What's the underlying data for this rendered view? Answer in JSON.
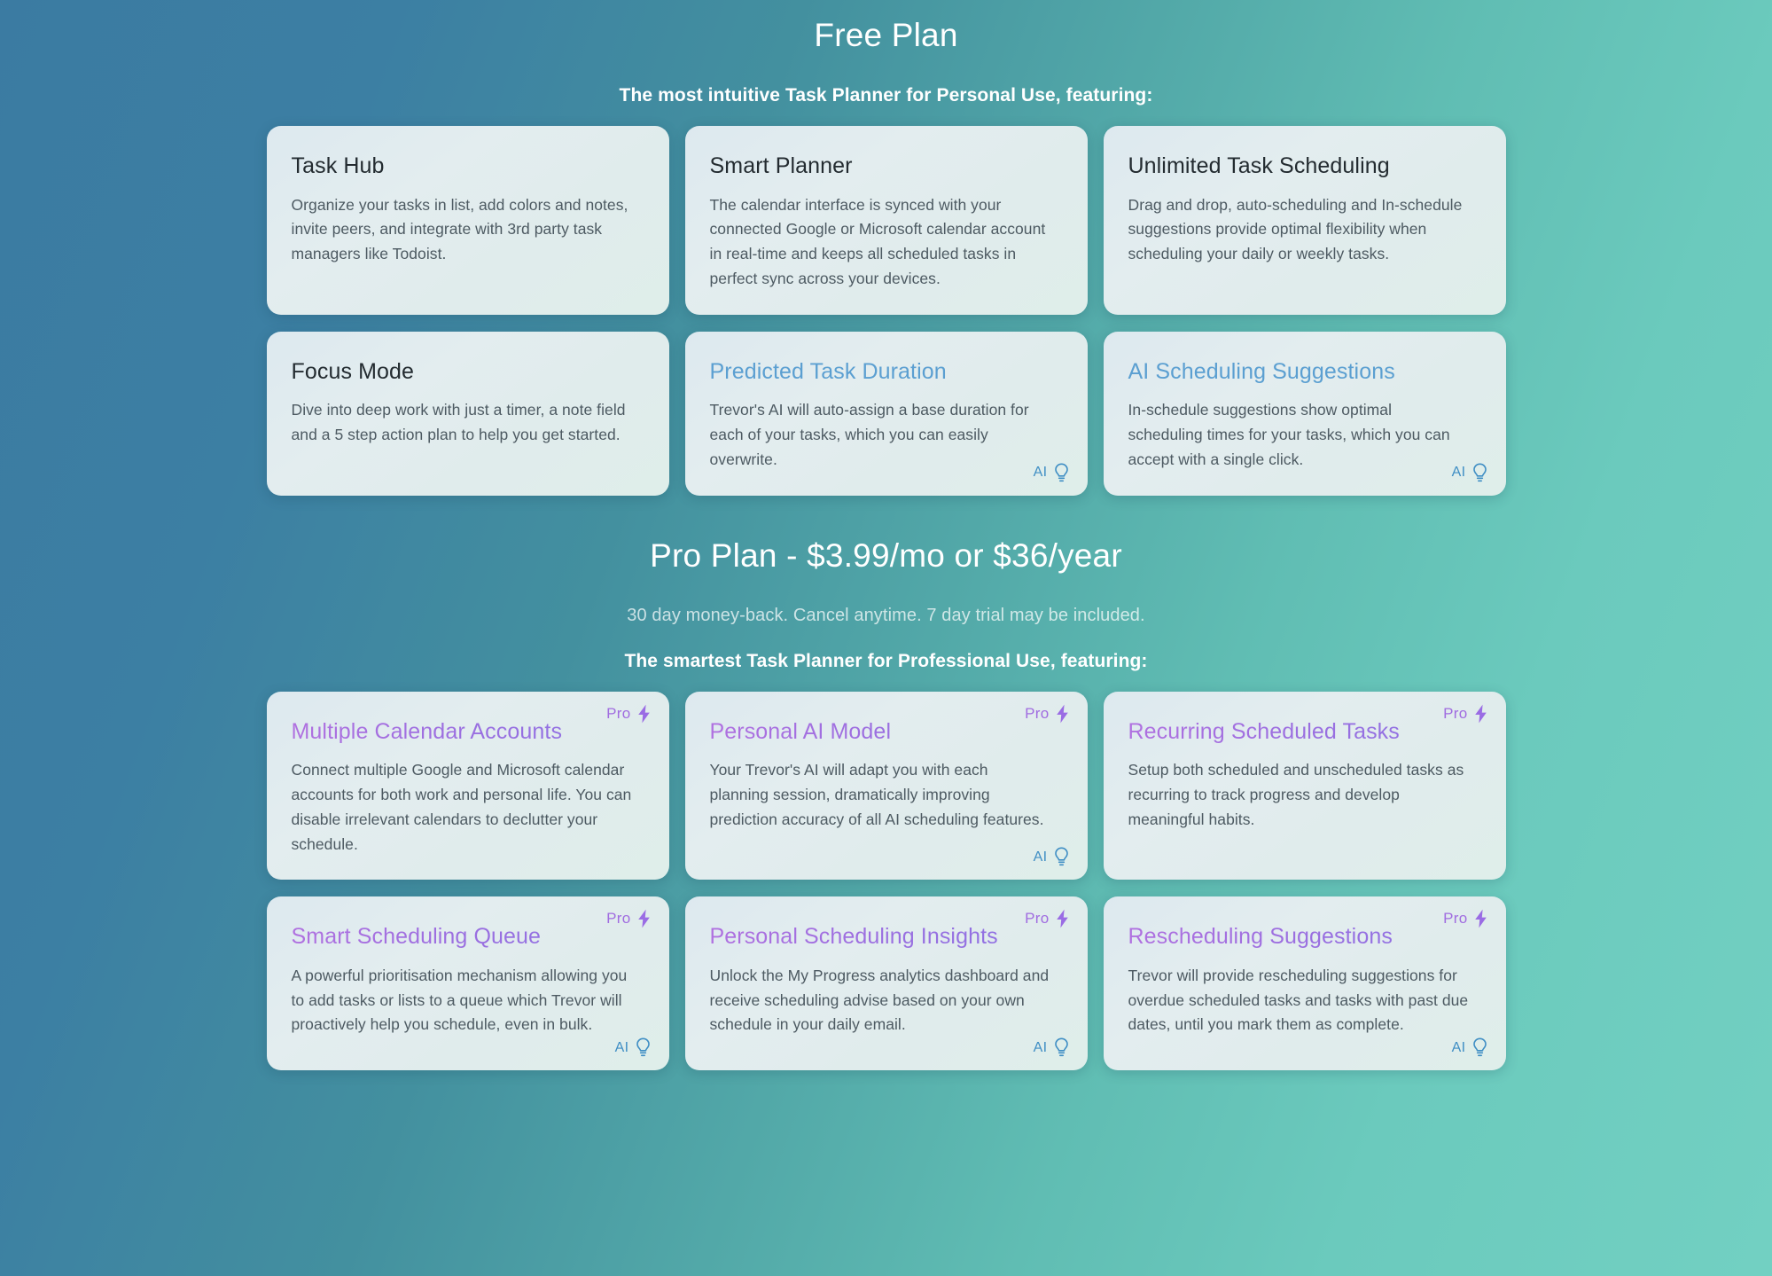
{
  "free_plan": {
    "title": "Free Plan",
    "subtitle": "The most intuitive Task Planner for Personal Use, featuring:",
    "cards": [
      {
        "title": "Task Hub",
        "desc": "Organize your tasks in list, add colors and notes, invite peers, and integrate with 3rd party task managers like Todoist.",
        "ai": false,
        "pro": false
      },
      {
        "title": "Smart Planner",
        "desc": "The calendar interface is synced with your connected Google or Microsoft calendar account in real-time and keeps all scheduled tasks in perfect sync across your devices.",
        "ai": false,
        "pro": false
      },
      {
        "title": "Unlimited Task Scheduling",
        "desc": "Drag and drop, auto-scheduling and In-schedule suggestions provide optimal flexibility when scheduling your daily or weekly tasks.",
        "ai": false,
        "pro": false
      },
      {
        "title": "Focus Mode",
        "desc": "Dive into deep work with just a timer, a note field and a 5 step action plan to help you get started.",
        "ai": false,
        "pro": false
      },
      {
        "title": "Predicted Task Duration",
        "desc": "Trevor's AI will auto-assign a base duration for each of your tasks, which you can easily overwrite.",
        "ai": true,
        "pro": false
      },
      {
        "title": "AI Scheduling Suggestions",
        "desc": "In-schedule suggestions show optimal scheduling times for your tasks, which you can accept with a single click.",
        "ai": true,
        "pro": false
      }
    ]
  },
  "pro_plan": {
    "title": "Pro Plan - $3.99/mo or $36/year",
    "note": "30 day money-back. Cancel anytime. 7 day trial may be included.",
    "subtitle": "The smartest Task Planner for Professional Use, featuring:",
    "cards": [
      {
        "title": "Multiple Calendar Accounts",
        "desc": "Connect multiple Google and Microsoft calendar accounts for both work and personal life. You can disable irrelevant calendars to declutter your schedule.",
        "ai": false,
        "pro": true
      },
      {
        "title": "Personal AI Model",
        "desc": "Your Trevor's AI will adapt you with each planning session, dramatically improving prediction accuracy of all AI scheduling features.",
        "ai": true,
        "pro": true
      },
      {
        "title": "Recurring Scheduled Tasks",
        "desc": "Setup both scheduled and unscheduled tasks as recurring to track progress and develop meaningful habits.",
        "ai": false,
        "pro": true
      },
      {
        "title": "Smart Scheduling Queue",
        "desc": "A powerful prioritisation mechanism allowing you to add tasks or lists to a queue which Trevor will proactively help you schedule, even in bulk.",
        "ai": true,
        "pro": true
      },
      {
        "title": "Personal Scheduling Insights",
        "desc": "Unlock the My Progress analytics dashboard and receive scheduling advise based on your own schedule in your daily email.",
        "ai": true,
        "pro": true
      },
      {
        "title": "Rescheduling Suggestions",
        "desc": "Trevor will provide rescheduling suggestions for overdue scheduled tasks and tasks with past due dates, until you mark them as complete.",
        "ai": true,
        "pro": true
      }
    ]
  },
  "badges": {
    "ai_label": "AI",
    "ai_icon": "lightbulb-icon",
    "pro_label": "Pro",
    "pro_icon": "lightning-bolt-icon"
  },
  "colors": {
    "bg_start": "#3b7ba2",
    "bg_end": "#72d0c2",
    "ai_accent": "#3f8ec4",
    "pro_accent": "#a06ce0",
    "card_bg": "#dfebef",
    "heading": "#ffffff",
    "body_text": "#4d5a62"
  }
}
